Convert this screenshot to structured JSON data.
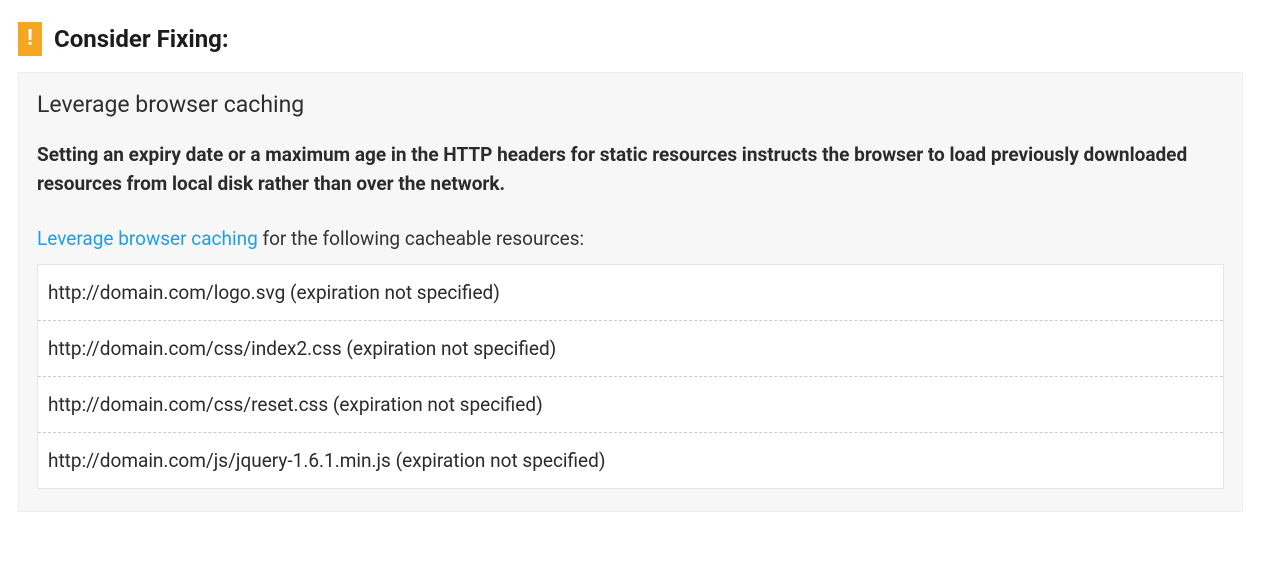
{
  "colors": {
    "badge_bg": "#f5a623",
    "link": "#1e9ee6",
    "panel_bg": "#f7f7f7"
  },
  "header": {
    "badge_glyph": "!",
    "title": "Consider Fixing:"
  },
  "panel": {
    "title": "Leverage browser caching",
    "description": "Setting an expiry date or a maximum age in the HTTP headers for static resources instructs the browser to load previously downloaded resources from local disk rather than over the network.",
    "link_text": "Leverage browser caching",
    "sub_text_suffix": " for the following cacheable resources:",
    "resources": [
      "http://domain.com/logo.svg (expiration not specified)",
      "http://domain.com/css/index2.css (expiration not specified)",
      "http://domain.com/css/reset.css (expiration not specified)",
      "http://domain.com/js/jquery-1.6.1.min.js (expiration not specified)"
    ]
  }
}
